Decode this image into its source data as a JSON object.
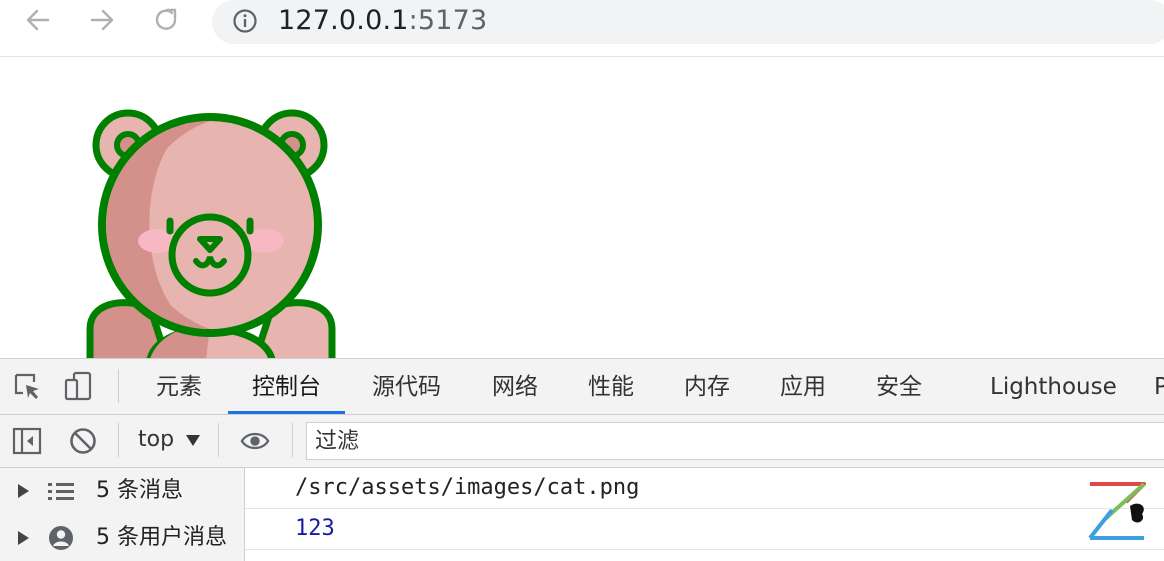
{
  "browser": {
    "url_host": "127.0.0.1",
    "url_port": ":5173",
    "back_icon": "arrow-left-icon",
    "forward_icon": "arrow-right-icon",
    "reload_icon": "reload-icon",
    "info_icon": "info-icon"
  },
  "page": {
    "image_icon": "bear-icon"
  },
  "devtools": {
    "tabs": [
      {
        "label": "元素"
      },
      {
        "label": "控制台",
        "active": true
      },
      {
        "label": "源代码"
      },
      {
        "label": "网络"
      },
      {
        "label": "性能"
      },
      {
        "label": "内存"
      },
      {
        "label": "应用"
      },
      {
        "label": "安全"
      },
      {
        "label": "Lighthouse"
      },
      {
        "label": "P"
      }
    ],
    "toolbar": {
      "context": "top",
      "filter_placeholder": "过滤"
    },
    "sidebar": {
      "items": [
        {
          "label": "5 条消息",
          "icon": "list-icon"
        },
        {
          "label": "5 条用户消息",
          "icon": "user-icon"
        }
      ]
    },
    "console": {
      "logs": [
        {
          "text": "/src/assets/images/cat.png",
          "type": "string"
        },
        {
          "text": "123",
          "type": "number"
        }
      ]
    }
  },
  "colors": {
    "accent": "#1a73e8",
    "bear_outline": "#008000",
    "bear_fur": "#e8b4b0",
    "bear_shade": "#d4908a",
    "cheek": "#f7b8c4"
  }
}
